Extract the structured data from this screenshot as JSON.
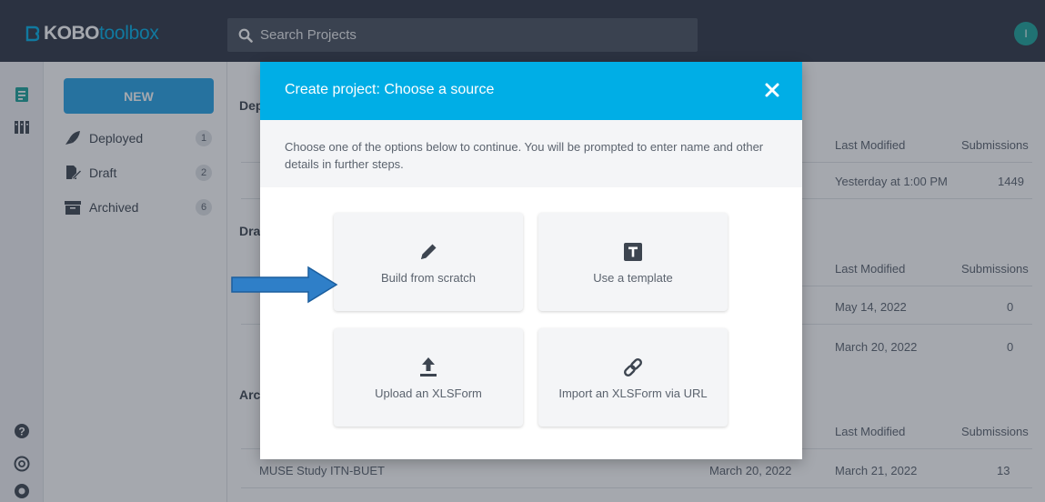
{
  "app": {
    "logo_kobo": "KOBO",
    "logo_toolbox": "toolbox",
    "avatar_initial": "I"
  },
  "search": {
    "placeholder": "Search Projects"
  },
  "sidebar": {
    "new_label": "NEW",
    "items": [
      {
        "label": "Deployed",
        "count": "1",
        "icon": "rocket-icon"
      },
      {
        "label": "Draft",
        "count": "2",
        "icon": "draft-icon"
      },
      {
        "label": "Archived",
        "count": "6",
        "icon": "archive-icon"
      }
    ]
  },
  "main": {
    "sections": [
      {
        "title_fragment": "Dep"
      },
      {
        "title_fragment": "Dra"
      },
      {
        "title_fragment": "Arc"
      }
    ],
    "columns": {
      "last_modified": "Last Modified",
      "submissions": "Submissions"
    },
    "deployed_rows": [
      {
        "last_modified": "Yesterday at 1:00 PM",
        "submissions": "1449"
      }
    ],
    "draft_rows": [
      {
        "last_modified": "May 14, 2022",
        "submissions": "0"
      },
      {
        "last_modified": "March 20, 2022",
        "submissions": "0"
      }
    ],
    "archived_rows": [
      {
        "name": "MUSE Study ITN-BUET",
        "date_created": "March 20, 2022",
        "last_modified": "March 21, 2022",
        "submissions": "13"
      }
    ]
  },
  "modal": {
    "title": "Create project: Choose a source",
    "intro": "Choose one of the options below to continue. You will be prompted to enter name and other details in further steps.",
    "options": [
      {
        "label": "Build from scratch",
        "icon": "pencil-icon"
      },
      {
        "label": "Use a template",
        "icon": "template-icon"
      },
      {
        "label": "Upload an XLSForm",
        "icon": "upload-icon"
      },
      {
        "label": "Import an XLSForm via URL",
        "icon": "link-icon"
      }
    ]
  },
  "colors": {
    "topbar": "#2d3444",
    "accent": "#00aee6",
    "new_button": "#25a3e6",
    "arrow": "#2f7fc8"
  }
}
